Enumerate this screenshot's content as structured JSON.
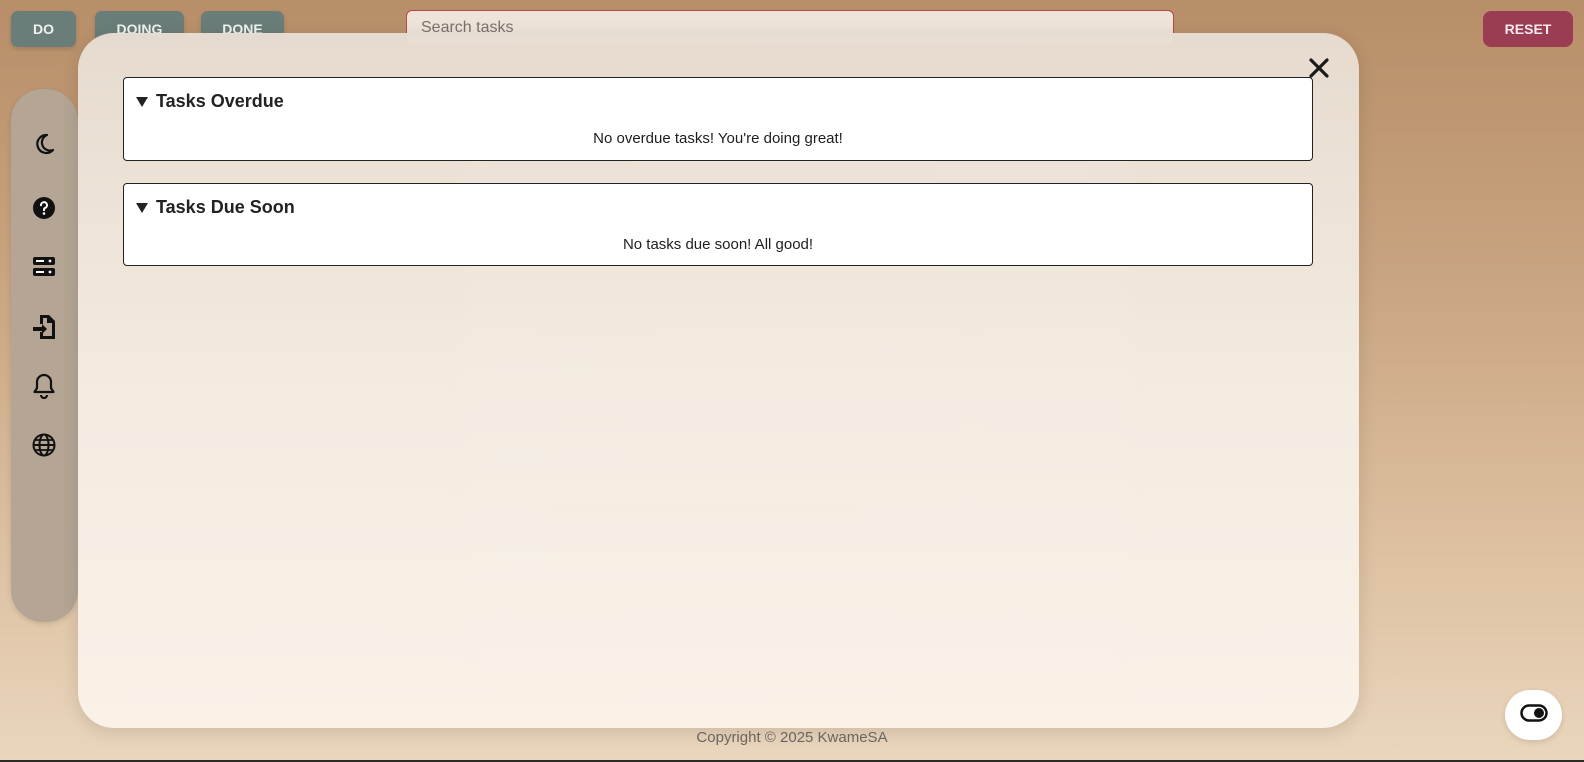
{
  "topbar": {
    "tabs": [
      {
        "label": "DO"
      },
      {
        "label": "DOING"
      },
      {
        "label": "DONE"
      }
    ],
    "search": {
      "placeholder": "Search tasks",
      "value": ""
    },
    "reset_label": "RESET"
  },
  "sidebar": {
    "items": [
      {
        "icon": "moon-icon"
      },
      {
        "icon": "help-icon"
      },
      {
        "icon": "storage-icon"
      },
      {
        "icon": "import-icon"
      },
      {
        "icon": "bell-icon"
      },
      {
        "icon": "globe-icon"
      }
    ]
  },
  "modal": {
    "close_icon": "close-icon",
    "panels": [
      {
        "summary": "Tasks Overdue",
        "message": "No overdue tasks! You're doing great!"
      },
      {
        "summary": "Tasks Due Soon",
        "message": "No tasks due soon! All good!"
      }
    ]
  },
  "footer": {
    "text": "Copyright © 2025 KwameSA"
  },
  "theme_toggle": {
    "icon": "toggle-icon"
  },
  "colors": {
    "tab_bg": "#6b7d78",
    "reset_bg": "#9b3d52",
    "search_border": "#b5484a",
    "sidebar_bg": "#b4a594"
  }
}
